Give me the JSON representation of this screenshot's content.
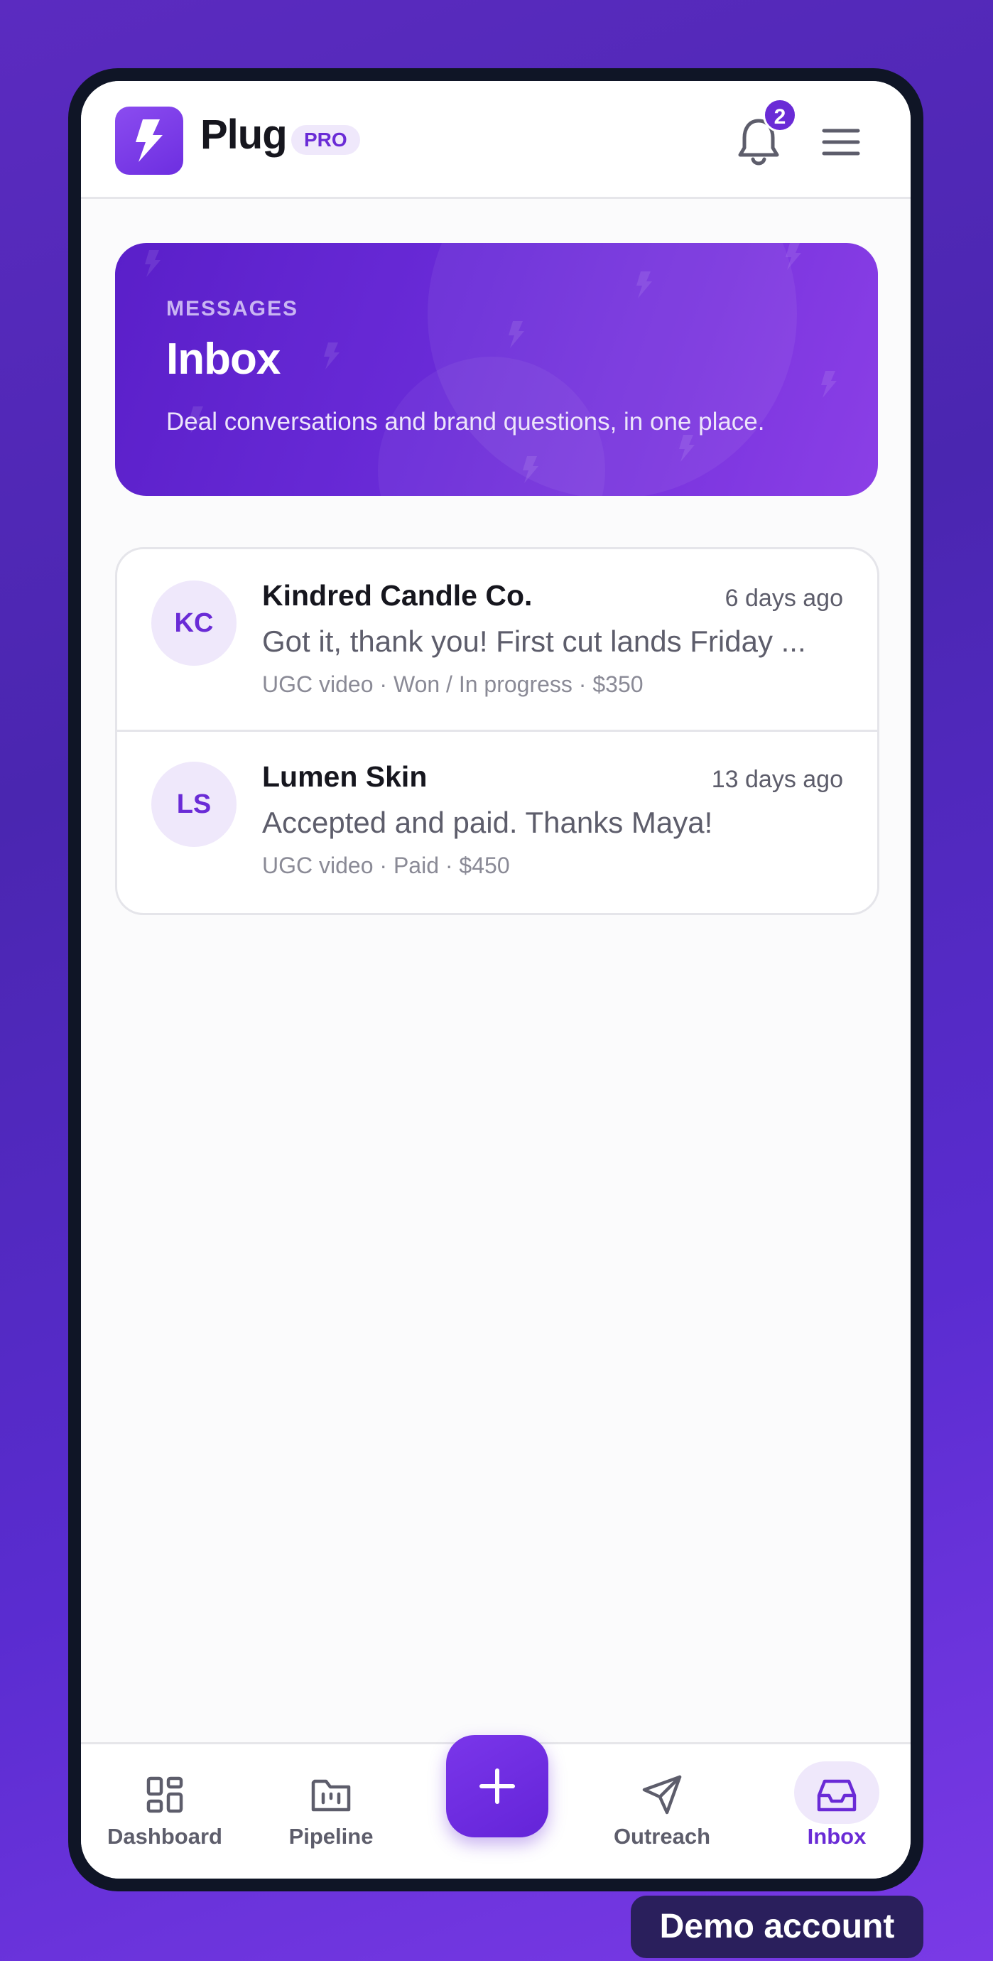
{
  "app": {
    "name": "Plug",
    "plan_badge": "PRO"
  },
  "notifications": {
    "count": "2"
  },
  "hero": {
    "eyebrow": "MESSAGES",
    "title": "Inbox",
    "subtitle": "Deal conversations and brand questions, in one place."
  },
  "conversations": [
    {
      "initials": "KC",
      "name": "Kindred Candle Co.",
      "time": "6 days ago",
      "preview": "Got it, thank you! First cut lands Friday ...",
      "meta": "UGC video · Won / In progress · $350"
    },
    {
      "initials": "LS",
      "name": "Lumen Skin",
      "time": "13 days ago",
      "preview": "Accepted and paid. Thanks Maya!",
      "meta": "UGC video · Paid · $450"
    }
  ],
  "nav": {
    "items": [
      {
        "label": "Dashboard",
        "icon": "dashboard-icon"
      },
      {
        "label": "Pipeline",
        "icon": "pipeline-folder-icon"
      },
      {
        "label": "Outreach",
        "icon": "send-icon"
      },
      {
        "label": "Inbox",
        "icon": "inbox-icon",
        "active": true
      }
    ],
    "fab_icon": "plus-icon"
  },
  "demo_label": "Demo account",
  "colors": {
    "accent": "#6a2bd6",
    "accent_soft": "#efe8fb",
    "text": "#16161e",
    "muted": "#5d5d6b"
  }
}
